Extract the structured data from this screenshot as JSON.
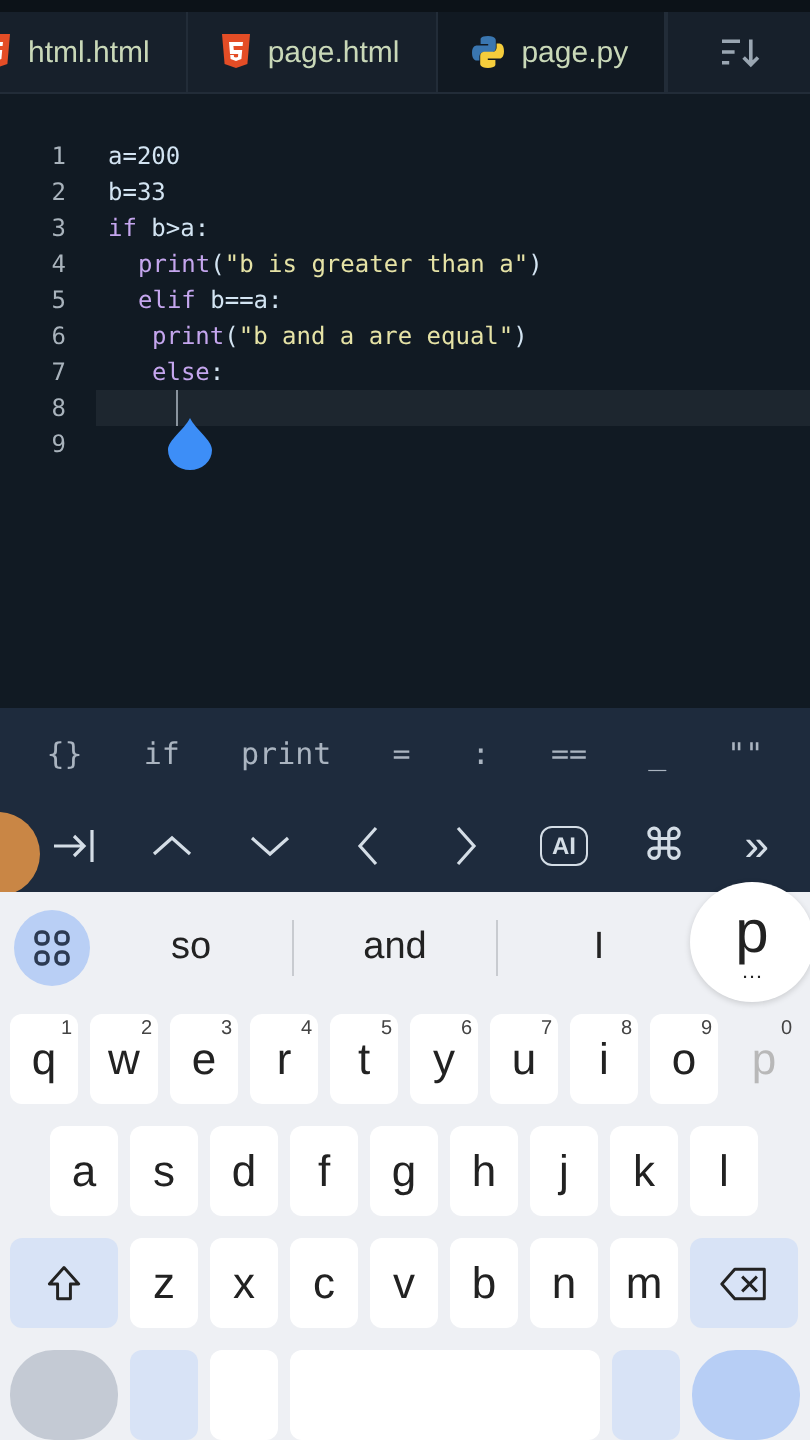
{
  "tabs": [
    {
      "kind": "html",
      "label": "html.html",
      "selected": false
    },
    {
      "kind": "html",
      "label": "page.html",
      "selected": false
    },
    {
      "kind": "python",
      "label": "page.py",
      "selected": true
    }
  ],
  "editor": {
    "lines": [
      {
        "number": "1",
        "active": false,
        "tokens": [
          {
            "kind": "plain",
            "text": "a=200"
          }
        ]
      },
      {
        "number": "2",
        "active": false,
        "tokens": [
          {
            "kind": "plain",
            "text": "b=33"
          }
        ]
      },
      {
        "number": "3",
        "active": false,
        "tokens": [
          {
            "kind": "keyword",
            "text": "if"
          },
          {
            "kind": "plain",
            "text": " b>a:"
          }
        ]
      },
      {
        "number": "4",
        "active": false,
        "kind": "block",
        "tokens": [
          {
            "kind": "keyword",
            "text": "print"
          },
          {
            "kind": "plain",
            "text": "("
          },
          {
            "kind": "string",
            "text": "\"b is greater than a\""
          },
          {
            "kind": "plain",
            "text": ")"
          }
        ]
      },
      {
        "number": "5",
        "active": false,
        "kind": "block",
        "tokens": [
          {
            "kind": "keyword",
            "text": "elif"
          },
          {
            "kind": "plain",
            "text": " b==a:"
          }
        ]
      },
      {
        "number": "6",
        "active": false,
        "kind": "inner",
        "tokens": [
          {
            "kind": "keyword",
            "text": "print"
          },
          {
            "kind": "plain",
            "text": "("
          },
          {
            "kind": "string",
            "text": "\"b and a are equal\""
          },
          {
            "kind": "plain",
            "text": ")"
          }
        ]
      },
      {
        "number": "7",
        "active": false,
        "kind": "inner",
        "tokens": [
          {
            "kind": "keyword",
            "text": "else"
          },
          {
            "kind": "plain",
            "text": ":"
          }
        ]
      },
      {
        "number": "8",
        "active": true
      },
      {
        "number": "9",
        "active": false
      }
    ]
  },
  "symbols": [
    "{}",
    "if",
    "print",
    "=",
    ":",
    "==",
    "_",
    "\"\""
  ],
  "nav_keys": [
    {
      "kind": "tab"
    },
    {
      "kind": "up"
    },
    {
      "kind": "down"
    },
    {
      "kind": "left"
    },
    {
      "kind": "right"
    },
    {
      "kind": "ai",
      "label": "AI"
    },
    {
      "kind": "glyph",
      "label": "⌘"
    },
    {
      "kind": "glyph",
      "label": "»"
    }
  ],
  "suggestions": [
    "so",
    "and",
    "I"
  ],
  "key_popup": {
    "letter": "p",
    "more": "…"
  },
  "keyboard": {
    "rows": [
      [
        {
          "kind": "letter",
          "label": "q",
          "hint": "1",
          "pressed": false
        },
        {
          "kind": "letter",
          "label": "w",
          "hint": "2",
          "pressed": false
        },
        {
          "kind": "letter",
          "label": "e",
          "hint": "3",
          "pressed": false
        },
        {
          "kind": "letter",
          "label": "r",
          "hint": "4",
          "pressed": false
        },
        {
          "kind": "letter",
          "label": "t",
          "hint": "5",
          "pressed": false
        },
        {
          "kind": "letter",
          "label": "y",
          "hint": "6",
          "pressed": false
        },
        {
          "kind": "letter",
          "label": "u",
          "hint": "7",
          "pressed": false
        },
        {
          "kind": "letter",
          "label": "i",
          "hint": "8",
          "pressed": false
        },
        {
          "kind": "letter",
          "label": "o",
          "hint": "9",
          "pressed": false
        },
        {
          "kind": "letter",
          "label": "p",
          "hint": "0",
          "pressed": true
        }
      ],
      [
        {
          "kind": "letter",
          "label": "a",
          "pressed": false
        },
        {
          "kind": "letter",
          "label": "s",
          "pressed": false
        },
        {
          "kind": "letter",
          "label": "d",
          "pressed": false
        },
        {
          "kind": "letter",
          "label": "f",
          "pressed": false
        },
        {
          "kind": "letter",
          "label": "g",
          "pressed": false
        },
        {
          "kind": "letter",
          "label": "h",
          "pressed": false
        },
        {
          "kind": "letter",
          "label": "j",
          "pressed": false
        },
        {
          "kind": "letter",
          "label": "k",
          "pressed": false
        },
        {
          "kind": "letter",
          "label": "l",
          "pressed": false
        }
      ],
      [
        {
          "kind": "shift"
        },
        {
          "kind": "letter",
          "label": "z",
          "pressed": false
        },
        {
          "kind": "letter",
          "label": "x",
          "pressed": false
        },
        {
          "kind": "letter",
          "label": "c",
          "pressed": false
        },
        {
          "kind": "letter",
          "label": "v",
          "pressed": false
        },
        {
          "kind": "letter",
          "label": "b",
          "pressed": false
        },
        {
          "kind": "letter",
          "label": "n",
          "pressed": false
        },
        {
          "kind": "letter",
          "label": "m",
          "pressed": false
        },
        {
          "kind": "backspace"
        }
      ]
    ]
  }
}
